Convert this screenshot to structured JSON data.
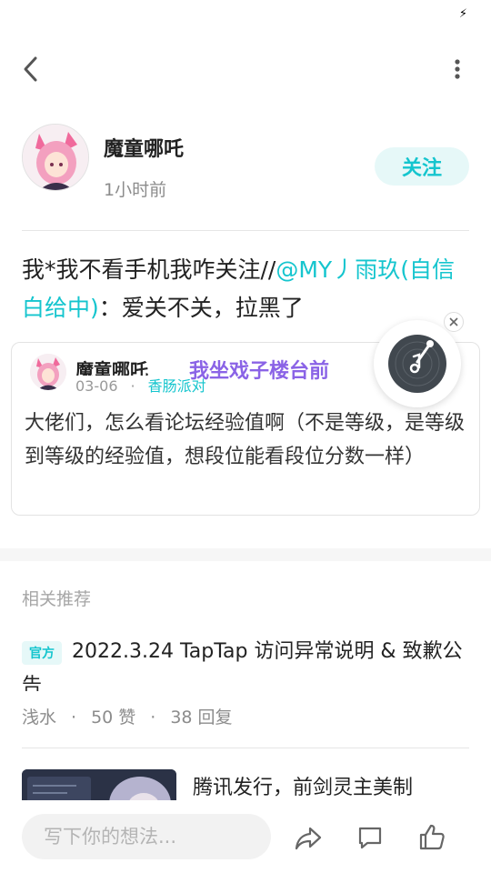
{
  "topbar": {
    "back_icon": "chevron-left-icon",
    "more_icon": "more-vertical-icon"
  },
  "author": {
    "name": "魔童哪吒",
    "time": "1小时前",
    "follow_label": "关注"
  },
  "post": {
    "prefix": "我*我不看手机我咋关注//",
    "mention": "@MY丿雨玖(自信白给中)",
    "suffix": "：爱关不关，拉黑了"
  },
  "quote": {
    "name": "魔童哪吒",
    "date": "03-06",
    "separator": "·",
    "forum": "香肠派对",
    "text": "大佬们，怎么看论坛经验值啊（不是等级，是等级到等级的经验值，想段位能看段位分数一样）"
  },
  "floating_label": "我坐戏子楼台前",
  "related": {
    "title": "相关推荐",
    "items": [
      {
        "badge": "官方",
        "title": "2022.3.24 TapTap 访问异常说明 & 致歉公告",
        "author": "浅水",
        "separator": "·",
        "likes": "50 赞",
        "replies": "38 回复"
      },
      {
        "title": "腾讯发行，前剑灵主美制"
      }
    ]
  },
  "bottom_bar": {
    "comment_placeholder": "写下你的想法...",
    "share_icon": "share-icon",
    "reply_icon": "comment-icon",
    "like_icon": "thumbs-up-icon"
  },
  "colors": {
    "accent": "#15c5ce",
    "floating_label": "#8a63e6",
    "text": "#222222",
    "muted": "#8c8c8c"
  }
}
